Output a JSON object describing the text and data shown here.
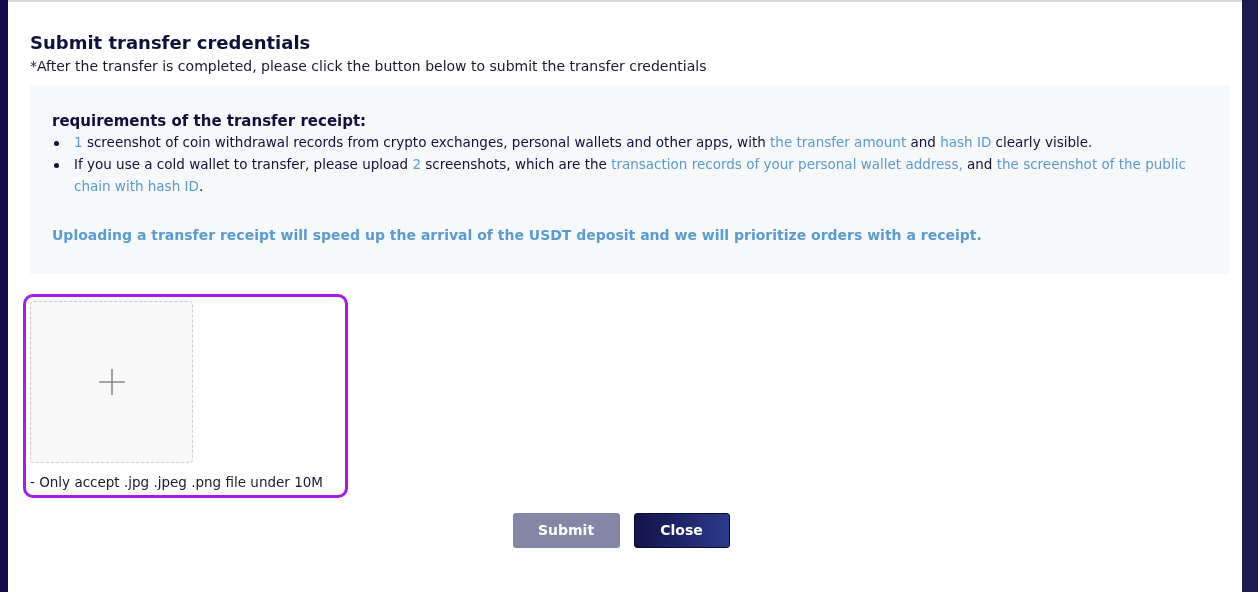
{
  "title": "Submit transfer credentials",
  "subtitle": "*After the transfer is completed, please click the button below to submit the transfer credentials",
  "requirements": {
    "heading": "requirements of the transfer receipt:",
    "items": [
      [
        {
          "text": "1",
          "highlight": true
        },
        {
          "text": " screenshot of coin withdrawal records from crypto exchanges, personal wallets and other apps, with ",
          "highlight": false
        },
        {
          "text": "the transfer amount",
          "highlight": true
        },
        {
          "text": " and ",
          "highlight": false
        },
        {
          "text": "hash ID",
          "highlight": true
        },
        {
          "text": " clearly visible.",
          "highlight": false
        }
      ],
      [
        {
          "text": "If you use a cold wallet to transfer, please upload ",
          "highlight": false
        },
        {
          "text": "2",
          "highlight": true
        },
        {
          "text": " screenshots, which are the ",
          "highlight": false
        },
        {
          "text": "transaction records of your personal wallet address,",
          "highlight": true
        },
        {
          "text": " and ",
          "highlight": false
        },
        {
          "text": "the screenshot of the public chain with hash ID",
          "highlight": true
        },
        {
          "text": ".",
          "highlight": false
        }
      ]
    ],
    "note": "Uploading a transfer receipt will speed up the arrival of the USDT deposit and we will prioritize orders with a receipt."
  },
  "upload": {
    "caption": "- Only accept .jpg .jpeg .png file under 10M",
    "highlighted": true
  },
  "buttons": [
    {
      "label": "Submit",
      "disabled": true
    },
    {
      "label": "Close",
      "disabled": false
    }
  ]
}
